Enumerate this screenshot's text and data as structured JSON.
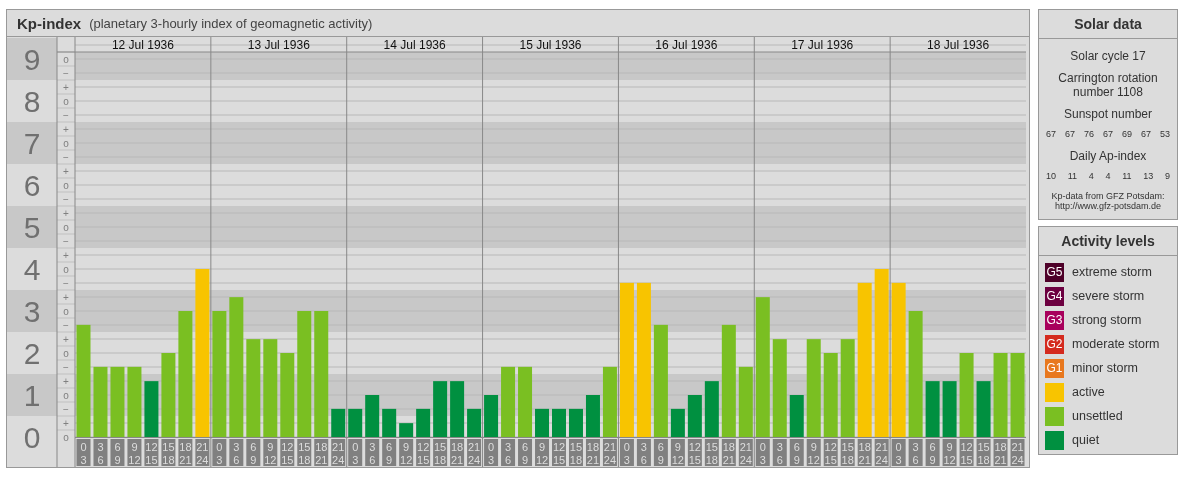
{
  "kp_panel": {
    "title": "Kp-index",
    "subtitle": "(planetary 3-hourly index of geomagnetic activity)",
    "days": [
      "12 Jul 1936",
      "13 Jul 1936",
      "14 Jul 1936",
      "15 Jul 1936",
      "16 Jul 1936",
      "17 Jul 1936",
      "18 Jul 1936"
    ],
    "subticks": [
      "o",
      "−",
      "+",
      "o",
      "−",
      "+",
      "o",
      "−",
      "+",
      "o",
      "−",
      "+",
      "o",
      "−",
      "+",
      "o",
      "−",
      "+",
      "o",
      "−",
      "+",
      "o",
      "−",
      "+",
      "o",
      "−",
      "+",
      "o"
    ],
    "chart_data": {
      "type": "bar",
      "stacked": true,
      "grid": true,
      "ylim": [
        0,
        9
      ],
      "yticks": [
        0,
        1,
        2,
        3,
        4,
        5,
        6,
        7,
        8,
        9
      ],
      "categories": [
        "0 3",
        "3 6",
        "6 9",
        "9 12",
        "12 15",
        "15 18",
        "18 21",
        "21 24",
        "0 3",
        "3 6",
        "6 9",
        "9 12",
        "12 15",
        "15 18",
        "18 21",
        "21 24",
        "0 3",
        "3 6",
        "6 9",
        "9 12",
        "12 15",
        "15 18",
        "18 21",
        "21 24",
        "0 3",
        "3 6",
        "6 9",
        "9 12",
        "12 15",
        "15 18",
        "18 21",
        "21 24",
        "0 3",
        "3 6",
        "6 9",
        "9 12",
        "12 15",
        "15 18",
        "18 21",
        "21 24",
        "0 3",
        "3 6",
        "6 9",
        "9 12",
        "12 15",
        "15 18",
        "18 21",
        "21 24",
        "0 3",
        "3 6",
        "6 9",
        "9 12",
        "12 15",
        "15 18",
        "18 21",
        "21 24"
      ],
      "series": [
        {
          "name": "quiet",
          "color": "#009040",
          "values": [
            null,
            null,
            null,
            null,
            1.33,
            null,
            null,
            null,
            null,
            null,
            null,
            null,
            null,
            null,
            null,
            0.67,
            0.67,
            1,
            0.67,
            0.33,
            0.67,
            1.33,
            1.33,
            0.67,
            1,
            null,
            null,
            0.67,
            0.67,
            0.67,
            1,
            null,
            null,
            null,
            null,
            0.67,
            1,
            1.33,
            null,
            null,
            null,
            null,
            1,
            null,
            null,
            null,
            null,
            null,
            null,
            null,
            1.33,
            1.33,
            null,
            1.33,
            null,
            null
          ]
        },
        {
          "name": "unsettled",
          "color": "#7abf22",
          "values": [
            2.67,
            1.67,
            1.67,
            1.67,
            null,
            2,
            3,
            null,
            3,
            3.33,
            2.33,
            2.33,
            2,
            3,
            3,
            null,
            null,
            null,
            null,
            null,
            null,
            null,
            null,
            null,
            null,
            1.67,
            1.67,
            null,
            null,
            null,
            null,
            1.67,
            null,
            null,
            2.67,
            null,
            null,
            null,
            2.67,
            1.67,
            3.33,
            2.33,
            null,
            2.33,
            2,
            2.33,
            null,
            null,
            null,
            3,
            null,
            null,
            2,
            null,
            2,
            2
          ]
        },
        {
          "name": "active",
          "color": "#f8c400",
          "values": [
            null,
            null,
            null,
            null,
            null,
            null,
            null,
            4,
            null,
            null,
            null,
            null,
            null,
            null,
            null,
            null,
            null,
            null,
            null,
            null,
            null,
            null,
            null,
            null,
            null,
            null,
            null,
            null,
            null,
            null,
            null,
            null,
            3.67,
            3.67,
            null,
            null,
            null,
            null,
            null,
            null,
            null,
            null,
            null,
            null,
            null,
            null,
            3.67,
            4,
            3.67,
            null,
            null,
            null,
            null,
            null,
            null,
            null
          ]
        }
      ]
    }
  },
  "solar_data": {
    "title": "Solar data",
    "solar_cycle": "Solar cycle 17",
    "carrington": "Carrington rotation number 1108",
    "sunspot_label": "Sunspot number",
    "sunspots": [
      "67",
      "67",
      "76",
      "67",
      "69",
      "67",
      "53"
    ],
    "ap_label": "Daily Ap-index",
    "ap": [
      "10",
      "11",
      "4",
      "4",
      "11",
      "13",
      "9"
    ],
    "source": "Kp-data from GFZ Potsdam:",
    "source_url": "http://www.gfz-potsdam.de"
  },
  "activity_levels": {
    "title": "Activity levels",
    "items": [
      {
        "badge": "G5",
        "label": "extreme storm",
        "color": "#4e0028"
      },
      {
        "badge": "G4",
        "label": "severe storm",
        "color": "#6c0040"
      },
      {
        "badge": "G3",
        "label": "strong storm",
        "color": "#a8005c"
      },
      {
        "badge": "G2",
        "label": "moderate storm",
        "color": "#d42a1e"
      },
      {
        "badge": "G1",
        "label": "minor storm",
        "color": "#e8781e"
      }
    ]
  }
}
